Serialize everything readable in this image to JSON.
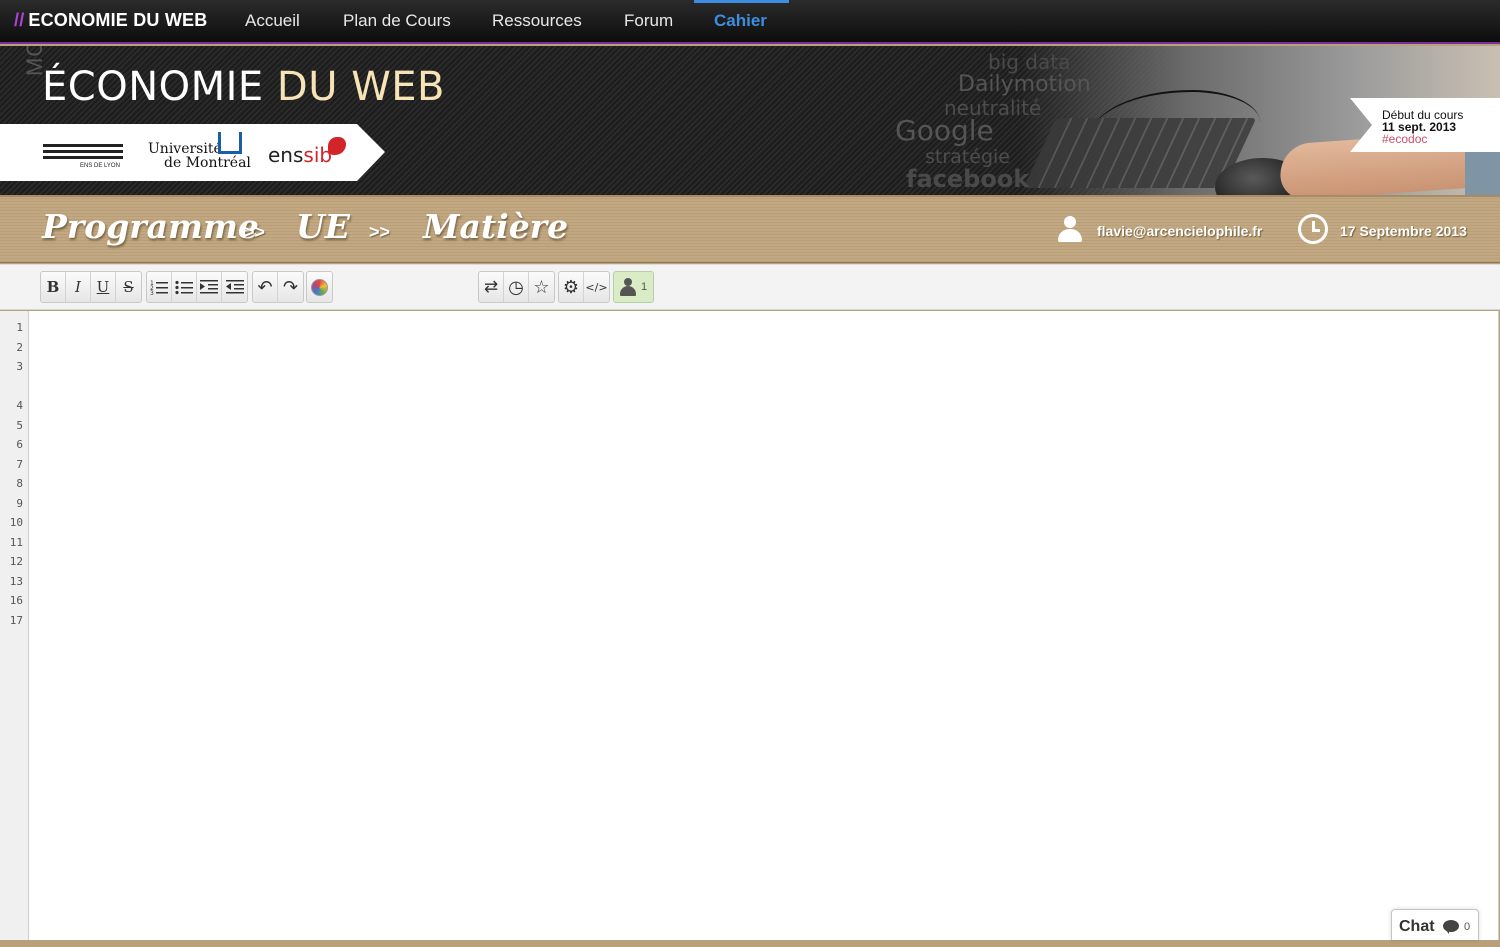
{
  "topnav": {
    "brand_prefix": "//",
    "brand": "ECONOMIE DU WEB",
    "items": [
      {
        "label": "Accueil"
      },
      {
        "label": "Plan de Cours"
      },
      {
        "label": "Ressources"
      },
      {
        "label": "Forum"
      },
      {
        "label": "Cahier",
        "active": true
      }
    ]
  },
  "banner": {
    "mooc_label": "MOOC",
    "title_main": "ÉCONOMIE",
    "title_accent": "DU WEB",
    "wordcloud": [
      "big data",
      "Dailymotion",
      "neutralité",
      "Google",
      "stratégie",
      "facebook"
    ],
    "logos": {
      "ens": "ENS DE LYON",
      "udm_line1": "Université",
      "udm_line2": "de Montréal",
      "enssib_a": "ens",
      "enssib_b": "sib"
    },
    "course_start": {
      "label": "Début du cours",
      "date": "11 sept. 2013",
      "hashtag": "#ecodoc"
    }
  },
  "breadcrumb": {
    "items": [
      "Programme",
      "UE",
      "Matière"
    ],
    "separator": ">>"
  },
  "user": {
    "email": "flavie@arcencielophile.fr",
    "date": "17 Septembre 2013"
  },
  "toolbar": {
    "bold": "B",
    "italic": "I",
    "underline": "U",
    "strike": "S",
    "ordered_list": "⒈☰",
    "unordered_list": "•☰",
    "indent": "⇥",
    "outdent": "⇤",
    "undo": "↶",
    "redo": "↷",
    "import_export": "⇄",
    "timeslider": "◷",
    "star": "☆",
    "settings": "⚙",
    "embed": "</>",
    "users_count": "1"
  },
  "editor": {
    "line_numbers": [
      "1",
      "2",
      "3",
      "4",
      "5",
      "6",
      "7",
      "8",
      "9",
      "10",
      "11",
      "12",
      "13",
      "16",
      "17"
    ]
  },
  "chat": {
    "label": "Chat",
    "count": "0"
  },
  "colors": {
    "accent_purple": "#b044d8",
    "active_blue": "#3d8ee0",
    "band_tan": "#c1a882"
  }
}
